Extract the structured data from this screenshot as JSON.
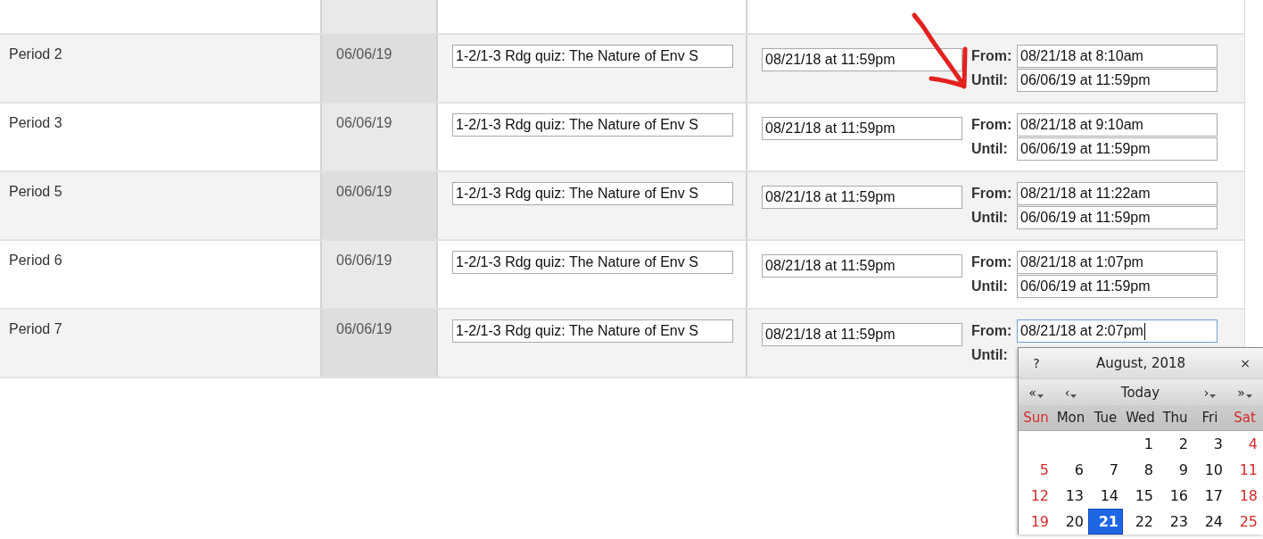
{
  "table": {
    "rows": [
      {
        "period": "Period 2",
        "date": "06/06/19",
        "title": "1-2/1-3 Rdg quiz: The Nature of Env S",
        "due": "08/21/18 at 11:59pm",
        "from": {
          "label": "From:",
          "value": "08/21/18 at 8:10am",
          "focused": false
        },
        "until": {
          "label": "Until:",
          "value": "06/06/19 at 11:59pm"
        }
      },
      {
        "period": "Period 3",
        "date": "06/06/19",
        "title": "1-2/1-3 Rdg quiz: The Nature of Env S",
        "due": "08/21/18 at 11:59pm",
        "from": {
          "label": "From:",
          "value": "08/21/18 at 9:10am",
          "focused": false
        },
        "until": {
          "label": "Until:",
          "value": "06/06/19 at 11:59pm"
        }
      },
      {
        "period": "Period 5",
        "date": "06/06/19",
        "title": "1-2/1-3 Rdg quiz: The Nature of Env S",
        "due": "08/21/18 at 11:59pm",
        "from": {
          "label": "From:",
          "value": "08/21/18 at 11:22am",
          "focused": false
        },
        "until": {
          "label": "Until:",
          "value": "06/06/19 at 11:59pm"
        }
      },
      {
        "period": "Period 6",
        "date": "06/06/19",
        "title": "1-2/1-3 Rdg quiz: The Nature of Env S",
        "due": "08/21/18 at 11:59pm",
        "from": {
          "label": "From:",
          "value": "08/21/18 at 1:07pm",
          "focused": false
        },
        "until": {
          "label": "Until:",
          "value": "06/06/19 at 11:59pm"
        }
      },
      {
        "period": "Period 7",
        "date": "06/06/19",
        "title": "1-2/1-3 Rdg quiz: The Nature of Env S",
        "due": "08/21/18 at 11:59pm",
        "from": {
          "label": "From:",
          "value": "08/21/18 at 2:07pm",
          "focused": true
        },
        "until": {
          "label": "Until:"
        }
      }
    ]
  },
  "calendar": {
    "help": "?",
    "title": "August, 2018",
    "close": "×",
    "nav": [
      {
        "label": "«",
        "menu": true
      },
      {
        "label": "‹",
        "menu": true
      },
      {
        "label": "Today",
        "menu": false
      },
      {
        "label": "›",
        "menu": true
      },
      {
        "label": "»",
        "menu": true
      }
    ],
    "weekdays": [
      {
        "label": "Sun",
        "weekend": true
      },
      {
        "label": "Mon",
        "weekend": false
      },
      {
        "label": "Tue",
        "weekend": false
      },
      {
        "label": "Wed",
        "weekend": false
      },
      {
        "label": "Thu",
        "weekend": false
      },
      {
        "label": "Fri",
        "weekend": false
      },
      {
        "label": "Sat",
        "weekend": true
      }
    ],
    "weeks": [
      [
        {
          "kind": "blank"
        },
        {
          "kind": "blank"
        },
        {
          "kind": "blank"
        },
        {
          "kind": "day",
          "day": "1",
          "weekend": false,
          "selected": false
        },
        {
          "kind": "day",
          "day": "2",
          "weekend": false,
          "selected": false
        },
        {
          "kind": "day",
          "day": "3",
          "weekend": false,
          "selected": false
        },
        {
          "kind": "day",
          "day": "4",
          "weekend": true,
          "selected": false
        }
      ],
      [
        {
          "kind": "day",
          "day": "5",
          "weekend": true,
          "selected": false
        },
        {
          "kind": "day",
          "day": "6",
          "weekend": false,
          "selected": false
        },
        {
          "kind": "day",
          "day": "7",
          "weekend": false,
          "selected": false
        },
        {
          "kind": "day",
          "day": "8",
          "weekend": false,
          "selected": false
        },
        {
          "kind": "day",
          "day": "9",
          "weekend": false,
          "selected": false
        },
        {
          "kind": "day",
          "day": "10",
          "weekend": false,
          "selected": false
        },
        {
          "kind": "day",
          "day": "11",
          "weekend": true,
          "selected": false
        }
      ],
      [
        {
          "kind": "day",
          "day": "12",
          "weekend": true,
          "selected": false
        },
        {
          "kind": "day",
          "day": "13",
          "weekend": false,
          "selected": false
        },
        {
          "kind": "day",
          "day": "14",
          "weekend": false,
          "selected": false
        },
        {
          "kind": "day",
          "day": "15",
          "weekend": false,
          "selected": false
        },
        {
          "kind": "day",
          "day": "16",
          "weekend": false,
          "selected": false
        },
        {
          "kind": "day",
          "day": "17",
          "weekend": false,
          "selected": false
        },
        {
          "kind": "day",
          "day": "18",
          "weekend": true,
          "selected": false
        }
      ],
      [
        {
          "kind": "day",
          "day": "19",
          "weekend": true,
          "selected": false
        },
        {
          "kind": "day",
          "day": "20",
          "weekend": false,
          "selected": false
        },
        {
          "kind": "day",
          "day": "21",
          "weekend": false,
          "selected": true
        },
        {
          "kind": "day",
          "day": "22",
          "weekend": false,
          "selected": false
        },
        {
          "kind": "day",
          "day": "23",
          "weekend": false,
          "selected": false
        },
        {
          "kind": "day",
          "day": "24",
          "weekend": false,
          "selected": false
        },
        {
          "kind": "day",
          "day": "25",
          "weekend": true,
          "selected": false
        }
      ]
    ]
  }
}
